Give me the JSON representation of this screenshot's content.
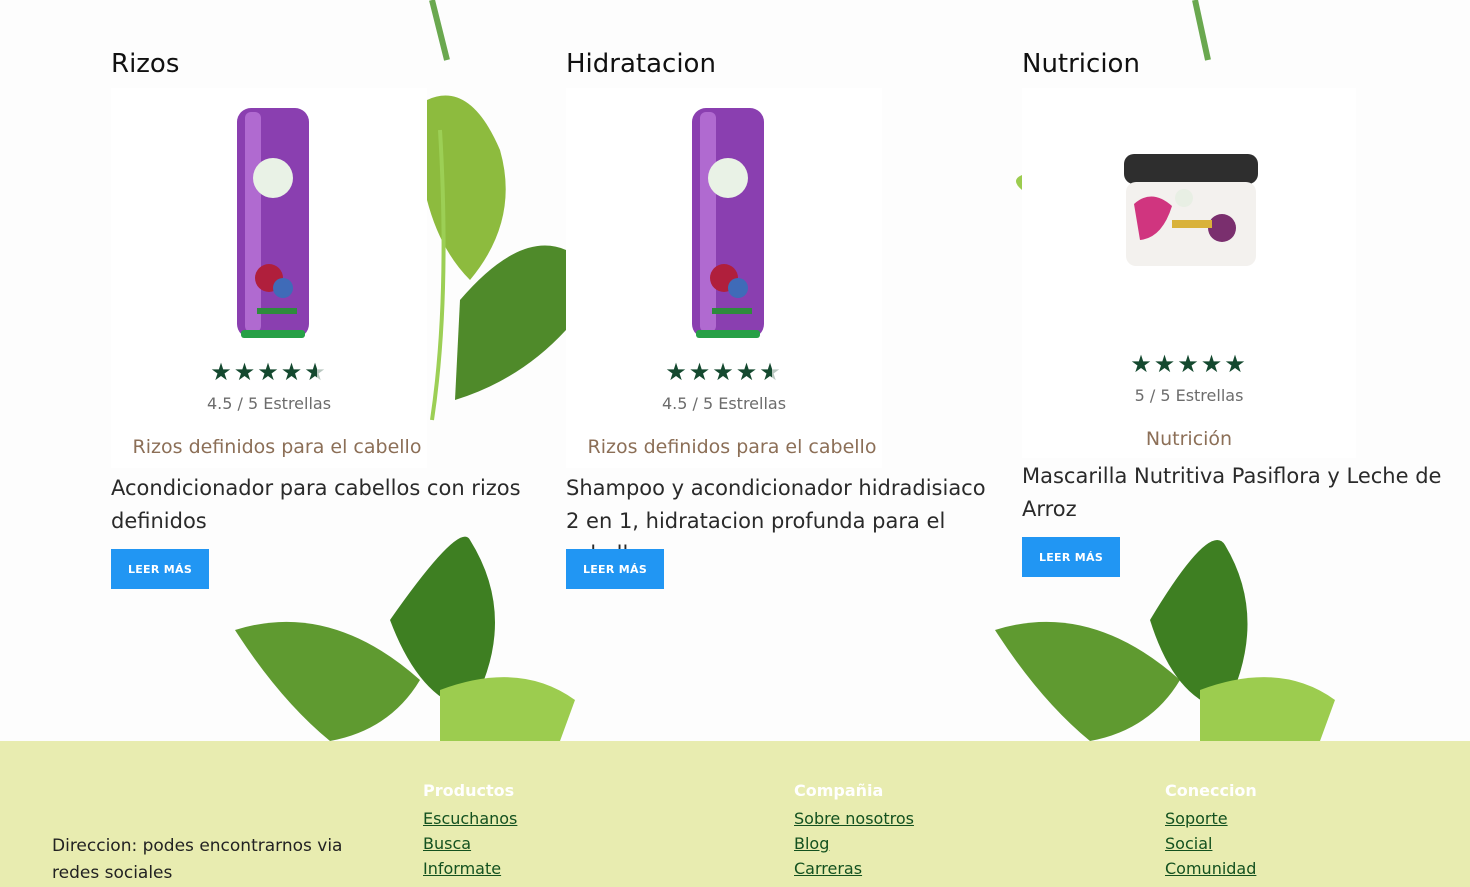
{
  "products": [
    {
      "category": "Rizos",
      "rating_value": 4.5,
      "rating_text": "4.5 / 5 Estrellas",
      "tagline": "Rizos definidos para el cabello",
      "description": "Acondicionador para cabellos con rizos definidos",
      "button": "LEER MÁS",
      "product_image": "purple-conditioner-bottle"
    },
    {
      "category": "Hidratacion",
      "rating_value": 4.5,
      "rating_text": "4.5 / 5 Estrellas",
      "tagline": "Rizos definidos para el cabello",
      "description": "Shampoo y acondicionador hidradisiaco 2 en 1, hidratacion profunda para el cabello",
      "button": "LEER MÁS",
      "product_image": "purple-conditioner-bottle"
    },
    {
      "category": "Nutricion",
      "rating_value": 5,
      "rating_text": "5 / 5 Estrellas",
      "tagline": "Nutrición",
      "description": "Mascarilla Nutritiva Pasiflora y Leche de Arroz",
      "button": "LEER MÁS",
      "product_image": "hair-mask-jar"
    }
  ],
  "footer": {
    "address": "Direccion: podes encontrarnos via redes sociales",
    "columns": [
      {
        "title": "Productos",
        "links": [
          "Escuchanos",
          "Busca",
          "Informate"
        ]
      },
      {
        "title": "Compañia",
        "links": [
          "Sobre nosotros",
          "Blog",
          "Carreras"
        ]
      },
      {
        "title": "Coneccion",
        "links": [
          "Soporte",
          "Social",
          "Comunidad"
        ]
      }
    ]
  },
  "colors": {
    "button": "#2196f3",
    "footer_bg": "#e8ecb0",
    "star": "#14492f",
    "footer_link": "#13511f"
  }
}
